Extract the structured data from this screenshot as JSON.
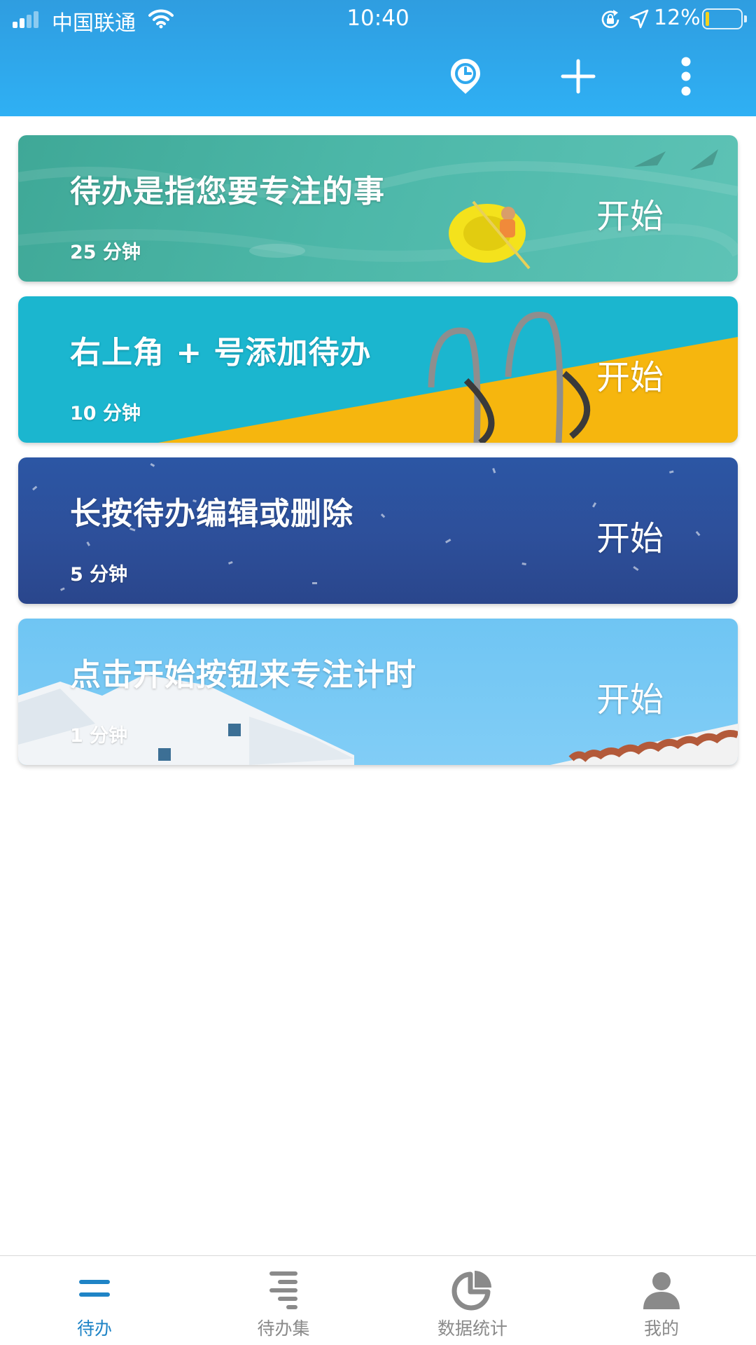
{
  "status_bar": {
    "carrier": "中国联通",
    "time": "10:40",
    "battery": "12%",
    "battery_level": 0.12,
    "icons": [
      "signal-icon",
      "wifi-icon",
      "rotation-lock-icon",
      "location-arrow-icon",
      "battery-icon"
    ]
  },
  "toolbar": {
    "icons": [
      "timer-pin-icon",
      "plus-icon",
      "more-vertical-icon"
    ],
    "color": "#2fa8ee"
  },
  "tasks": [
    {
      "title": "待办是指您要专注的事",
      "duration": "25 分钟",
      "action": "开始"
    },
    {
      "title": "右上角 + 号添加待办",
      "duration": "10 分钟",
      "action": "开始"
    },
    {
      "title": "长按待办编辑或删除",
      "duration": "5 分钟",
      "action": "开始"
    },
    {
      "title": "点击开始按钮来专注计时",
      "duration": "1 分钟",
      "action": "开始"
    }
  ],
  "tabbar": {
    "active_color": "#1f84c6",
    "inactive_color": "#8a8a8a",
    "tabs": [
      {
        "label": "待办",
        "icon": "todo-icon",
        "active": true
      },
      {
        "label": "待办集",
        "icon": "todo-list-icon",
        "active": false
      },
      {
        "label": "数据统计",
        "icon": "pie-chart-icon",
        "active": false
      },
      {
        "label": "我的",
        "icon": "profile-icon",
        "active": false
      }
    ]
  }
}
